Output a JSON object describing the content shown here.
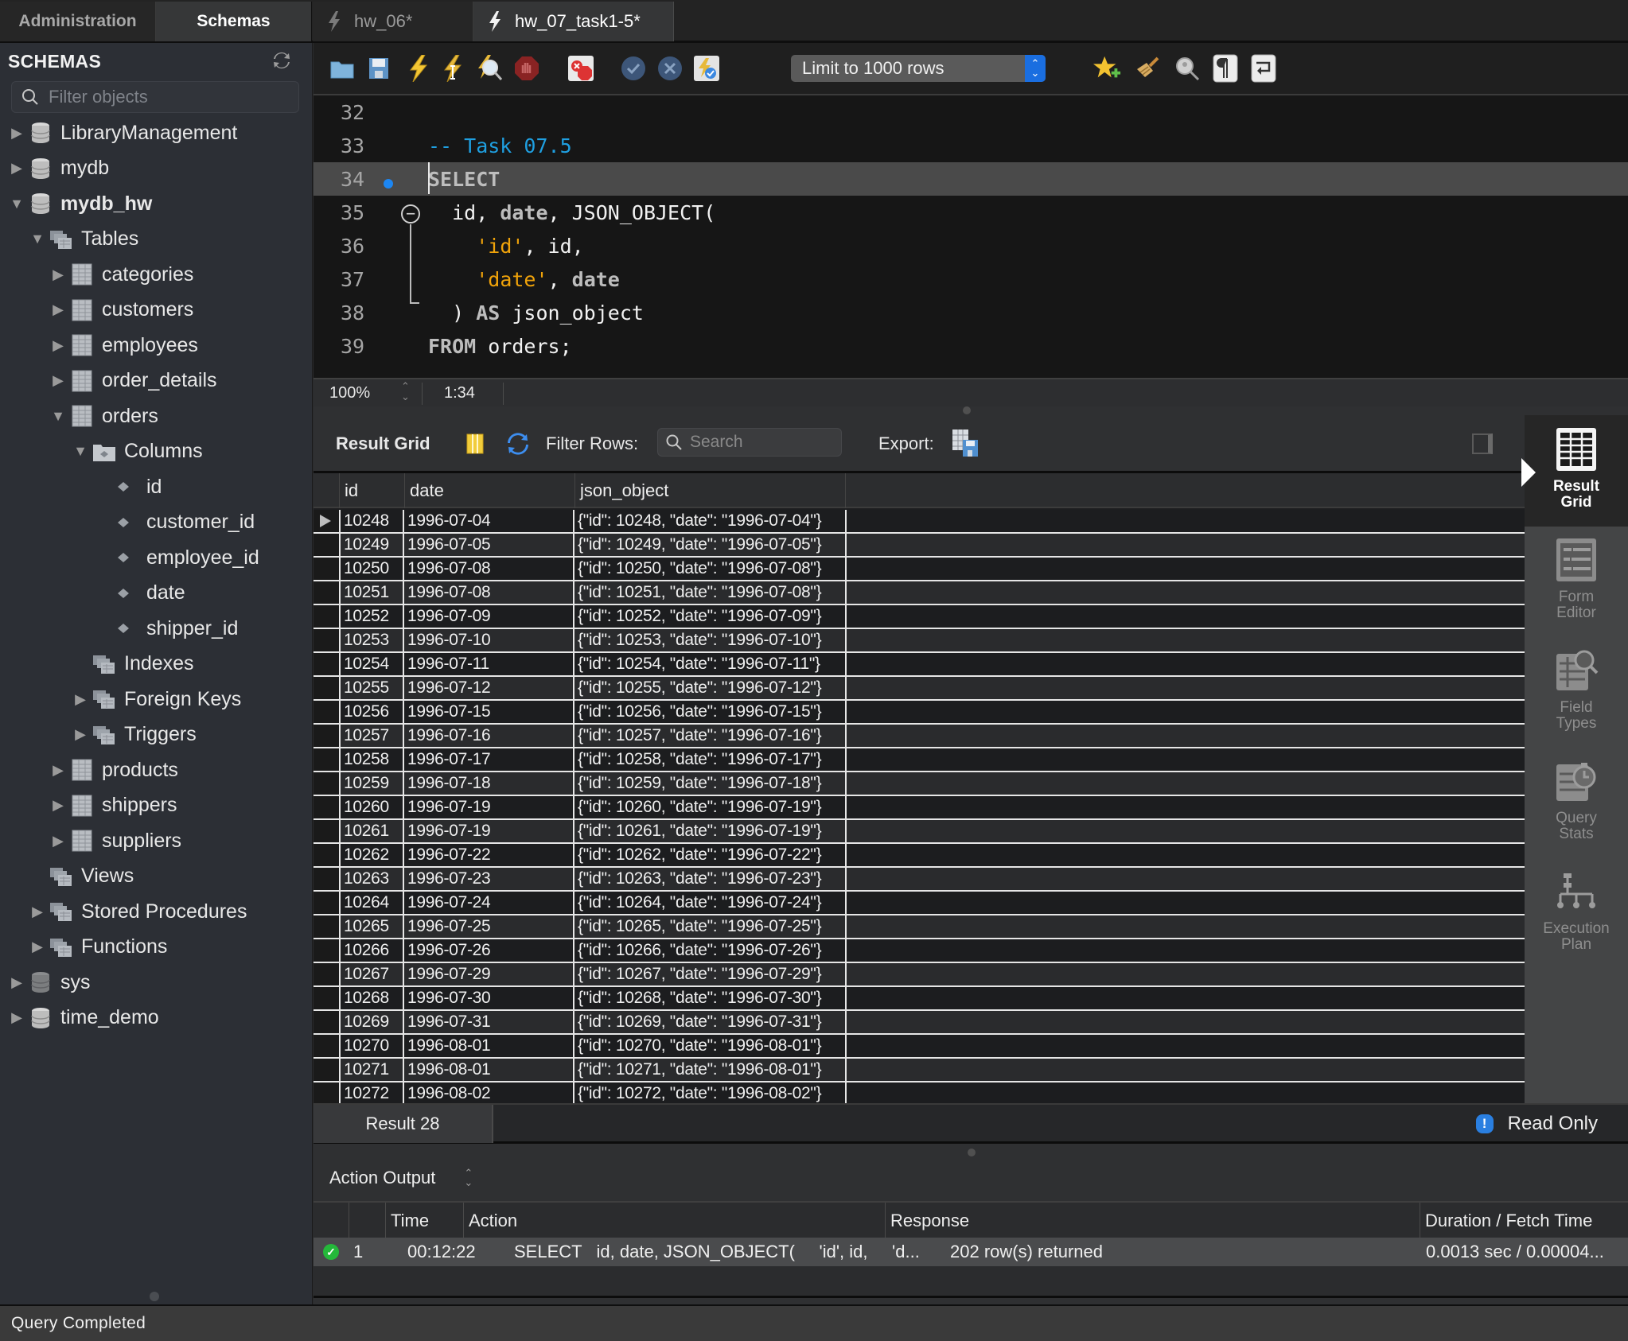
{
  "sidebar_tabs": {
    "administration": "Administration",
    "schemas": "Schemas"
  },
  "document_tabs": [
    {
      "label": "hw_06*",
      "active": false
    },
    {
      "label": "hw_07_task1-5*",
      "active": true
    }
  ],
  "sidebar": {
    "heading": "SCHEMAS",
    "filter_placeholder": "Filter objects",
    "tree": [
      {
        "label": "LibraryManagement",
        "type": "schema",
        "expanded": false,
        "level": 0
      },
      {
        "label": "mydb",
        "type": "schema",
        "expanded": false,
        "level": 0
      },
      {
        "label": "mydb_hw",
        "type": "schema",
        "expanded": true,
        "level": 0,
        "bold": true
      },
      {
        "label": "Tables",
        "type": "group",
        "expanded": true,
        "level": 1
      },
      {
        "label": "categories",
        "type": "table",
        "expanded": false,
        "level": 2
      },
      {
        "label": "customers",
        "type": "table",
        "expanded": false,
        "level": 2
      },
      {
        "label": "employees",
        "type": "table",
        "expanded": false,
        "level": 2
      },
      {
        "label": "order_details",
        "type": "table",
        "expanded": false,
        "level": 2
      },
      {
        "label": "orders",
        "type": "table",
        "expanded": true,
        "level": 2
      },
      {
        "label": "Columns",
        "type": "columns-group",
        "expanded": true,
        "level": 3
      },
      {
        "label": "id",
        "type": "column",
        "level": 4
      },
      {
        "label": "customer_id",
        "type": "column",
        "level": 4
      },
      {
        "label": "employee_id",
        "type": "column",
        "level": 4
      },
      {
        "label": "date",
        "type": "column",
        "level": 4
      },
      {
        "label": "shipper_id",
        "type": "column",
        "level": 4
      },
      {
        "label": "Indexes",
        "type": "group",
        "level": 3
      },
      {
        "label": "Foreign Keys",
        "type": "group",
        "expanded": false,
        "level": 3
      },
      {
        "label": "Triggers",
        "type": "group",
        "expanded": false,
        "level": 3
      },
      {
        "label": "products",
        "type": "table",
        "expanded": false,
        "level": 2
      },
      {
        "label": "shippers",
        "type": "table",
        "expanded": false,
        "level": 2
      },
      {
        "label": "suppliers",
        "type": "table",
        "expanded": false,
        "level": 2
      },
      {
        "label": "Views",
        "type": "group",
        "level": 1
      },
      {
        "label": "Stored Procedures",
        "type": "group",
        "expanded": false,
        "level": 1
      },
      {
        "label": "Functions",
        "type": "group",
        "expanded": false,
        "level": 1
      },
      {
        "label": "sys",
        "type": "schema",
        "expanded": false,
        "level": 0,
        "dim": true
      },
      {
        "label": "time_demo",
        "type": "schema",
        "expanded": false,
        "level": 0
      }
    ]
  },
  "toolbar": {
    "icons": [
      "open-file-icon",
      "save-icon",
      "execute-icon",
      "execute-current-icon",
      "explain-icon",
      "stop-icon",
      "toggle-error-stop-icon",
      "commit-icon",
      "rollback-icon",
      "autocommit-icon",
      "add-snippet-icon",
      "beautify-icon",
      "find-icon",
      "invisible-chars-icon",
      "word-wrap-icon"
    ],
    "limit_select": "Limit to 1000 rows"
  },
  "editor": {
    "lines": [
      {
        "n": "32",
        "tokens": []
      },
      {
        "n": "33",
        "tokens": [
          {
            "t": "-- Task 07.5",
            "c": "cmt"
          }
        ]
      },
      {
        "n": "34",
        "current": true,
        "tokens": [
          {
            "t": "SELECT",
            "c": "kwb"
          }
        ]
      },
      {
        "n": "35",
        "tokens": [
          {
            "t": "  id, ",
            "c": "ident"
          },
          {
            "t": "date",
            "c": "kwb"
          },
          {
            "t": ", JSON_OBJECT(",
            "c": "ident"
          }
        ]
      },
      {
        "n": "36",
        "tokens": [
          {
            "t": "    ",
            "c": "ident"
          },
          {
            "t": "'id'",
            "c": "str"
          },
          {
            "t": ", id,",
            "c": "ident"
          }
        ]
      },
      {
        "n": "37",
        "tokens": [
          {
            "t": "    ",
            "c": "ident"
          },
          {
            "t": "'date'",
            "c": "str"
          },
          {
            "t": ", ",
            "c": "ident"
          },
          {
            "t": "date",
            "c": "kwb"
          }
        ]
      },
      {
        "n": "38",
        "tokens": [
          {
            "t": "  ) ",
            "c": "ident"
          },
          {
            "t": "AS",
            "c": "kwb"
          },
          {
            "t": " json_object",
            "c": "ident"
          }
        ]
      },
      {
        "n": "39",
        "tokens": [
          {
            "t": "FROM",
            "c": "kwb"
          },
          {
            "t": " orders;",
            "c": "ident"
          }
        ]
      }
    ],
    "zoom": "100%",
    "cursor_position": "1:34"
  },
  "result": {
    "label": "Result Grid",
    "filter_label": "Filter Rows:",
    "search_placeholder": "Search",
    "export_label": "Export:",
    "columns": [
      "id",
      "date",
      "json_object"
    ],
    "rows": [
      [
        "10248",
        "1996-07-04",
        "{\"id\": 10248, \"date\": \"1996-07-04\"}"
      ],
      [
        "10249",
        "1996-07-05",
        "{\"id\": 10249, \"date\": \"1996-07-05\"}"
      ],
      [
        "10250",
        "1996-07-08",
        "{\"id\": 10250, \"date\": \"1996-07-08\"}"
      ],
      [
        "10251",
        "1996-07-08",
        "{\"id\": 10251, \"date\": \"1996-07-08\"}"
      ],
      [
        "10252",
        "1996-07-09",
        "{\"id\": 10252, \"date\": \"1996-07-09\"}"
      ],
      [
        "10253",
        "1996-07-10",
        "{\"id\": 10253, \"date\": \"1996-07-10\"}"
      ],
      [
        "10254",
        "1996-07-11",
        "{\"id\": 10254, \"date\": \"1996-07-11\"}"
      ],
      [
        "10255",
        "1996-07-12",
        "{\"id\": 10255, \"date\": \"1996-07-12\"}"
      ],
      [
        "10256",
        "1996-07-15",
        "{\"id\": 10256, \"date\": \"1996-07-15\"}"
      ],
      [
        "10257",
        "1996-07-16",
        "{\"id\": 10257, \"date\": \"1996-07-16\"}"
      ],
      [
        "10258",
        "1996-07-17",
        "{\"id\": 10258, \"date\": \"1996-07-17\"}"
      ],
      [
        "10259",
        "1996-07-18",
        "{\"id\": 10259, \"date\": \"1996-07-18\"}"
      ],
      [
        "10260",
        "1996-07-19",
        "{\"id\": 10260, \"date\": \"1996-07-19\"}"
      ],
      [
        "10261",
        "1996-07-19",
        "{\"id\": 10261, \"date\": \"1996-07-19\"}"
      ],
      [
        "10262",
        "1996-07-22",
        "{\"id\": 10262, \"date\": \"1996-07-22\"}"
      ],
      [
        "10263",
        "1996-07-23",
        "{\"id\": 10263, \"date\": \"1996-07-23\"}"
      ],
      [
        "10264",
        "1996-07-24",
        "{\"id\": 10264, \"date\": \"1996-07-24\"}"
      ],
      [
        "10265",
        "1996-07-25",
        "{\"id\": 10265, \"date\": \"1996-07-25\"}"
      ],
      [
        "10266",
        "1996-07-26",
        "{\"id\": 10266, \"date\": \"1996-07-26\"}"
      ],
      [
        "10267",
        "1996-07-29",
        "{\"id\": 10267, \"date\": \"1996-07-29\"}"
      ],
      [
        "10268",
        "1996-07-30",
        "{\"id\": 10268, \"date\": \"1996-07-30\"}"
      ],
      [
        "10269",
        "1996-07-31",
        "{\"id\": 10269, \"date\": \"1996-07-31\"}"
      ],
      [
        "10270",
        "1996-08-01",
        "{\"id\": 10270, \"date\": \"1996-08-01\"}"
      ],
      [
        "10271",
        "1996-08-01",
        "{\"id\": 10271, \"date\": \"1996-08-01\"}"
      ],
      [
        "10272",
        "1996-08-02",
        "{\"id\": 10272, \"date\": \"1996-08-02\"}"
      ]
    ],
    "tab_label": "Result 28",
    "read_only": "Read Only"
  },
  "view_panel": [
    {
      "label_1": "Result",
      "label_2": "Grid",
      "active": true,
      "icon": "result-grid-icon"
    },
    {
      "label_1": "Form",
      "label_2": "Editor",
      "active": false,
      "icon": "form-editor-icon"
    },
    {
      "label_1": "Field",
      "label_2": "Types",
      "active": false,
      "icon": "field-types-icon"
    },
    {
      "label_1": "Query",
      "label_2": "Stats",
      "active": false,
      "icon": "query-stats-icon"
    },
    {
      "label_1": "Execution",
      "label_2": "Plan",
      "active": false,
      "icon": "execution-plan-icon"
    }
  ],
  "action_output": {
    "selector": "Action Output",
    "columns": [
      "",
      "",
      "Time",
      "Action",
      "Response",
      "Duration / Fetch Time"
    ],
    "rows": [
      {
        "status": "success",
        "index": "1",
        "time": "00:12:22",
        "action": "SELECT   id, date, JSON_OBJECT(     'id', id,     'd...",
        "response": "202 row(s) returned",
        "duration": "0.0013 sec / 0.00004..."
      }
    ]
  },
  "status_bar": "Query Completed",
  "colors": {
    "accent_blue": "#1a6ee0",
    "comment": "#1f9fe0",
    "string": "#f0a30a",
    "success": "#24b83a"
  }
}
